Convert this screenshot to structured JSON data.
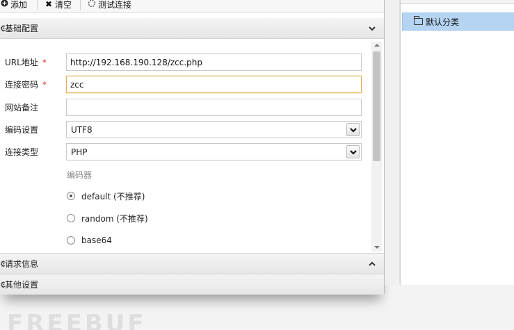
{
  "toolbar": {
    "add_label": "添加",
    "clear_label": "清空",
    "test_label": "测试连接"
  },
  "sections": {
    "basic": "基础配置",
    "request": "请求信息",
    "other": "其他设置"
  },
  "form": {
    "url": {
      "label": "URL地址",
      "required": "*",
      "value": "http://192.168.190.128/zcc.php"
    },
    "password": {
      "label": "连接密码",
      "required": "*",
      "value": "zcc"
    },
    "note": {
      "label": "网站备注",
      "value": ""
    },
    "encoding": {
      "label": "编码设置",
      "value": "UTF8"
    },
    "type": {
      "label": "连接类型",
      "value": "PHP"
    },
    "encoder": {
      "label": "编码器",
      "options": [
        "default (不推荐)",
        "random (不推荐)",
        "base64"
      ],
      "selected_index": 0
    }
  },
  "right_panel": {
    "item_label": "默认分类"
  },
  "watermark_text": "FREEBUF",
  "colors": {
    "selected_bg": "#b5d4f2",
    "focus_border": "#e3b15a",
    "required": "#e03030"
  }
}
